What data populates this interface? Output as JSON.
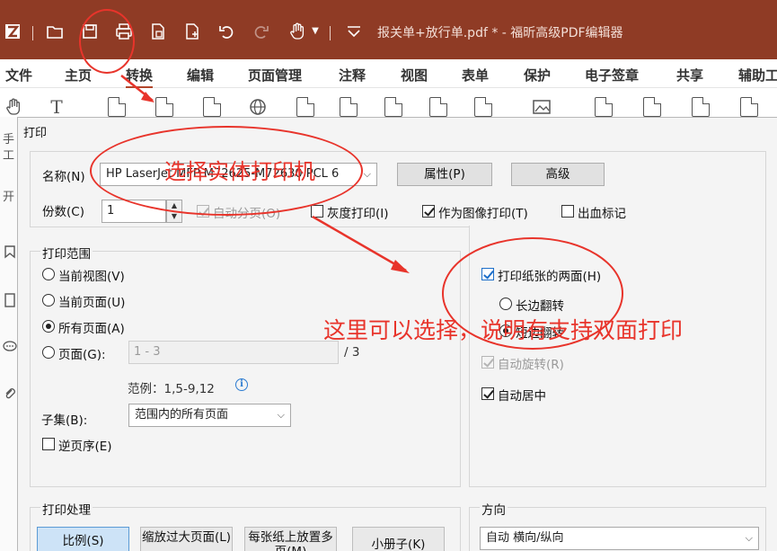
{
  "titlebar": {
    "document_title": "报关单+放行单.pdf * - 福昕高级PDF编辑器"
  },
  "menu": {
    "items": [
      "文件",
      "主页",
      "转换",
      "编辑",
      "页面管理",
      "注释",
      "视图",
      "表单",
      "保护",
      "电子签章",
      "共享",
      "辅助工"
    ]
  },
  "sidebar_clipped": [
    "手",
    "工",
    "开"
  ],
  "dialog": {
    "title": "打印",
    "printer": {
      "name_label": "名称(N)",
      "selected": "HP LaserJet MFP M72625-M72630 PCL 6",
      "properties_button": "属性(P)",
      "advanced_button": "高级"
    },
    "copies": {
      "label": "份数(C)",
      "value": "1"
    },
    "options": {
      "collate": {
        "label": "自动分页(O)",
        "checked": true,
        "disabled": true
      },
      "grayscale": {
        "label": "灰度打印(I)",
        "checked": false
      },
      "as_image": {
        "label": "作为图像打印(T)",
        "checked": true
      },
      "bleed_marks": {
        "label": "出血标记",
        "checked": false
      }
    },
    "print_range": {
      "title": "打印范围",
      "current_view": "当前视图(V)",
      "current_page": "当前页面(U)",
      "all_pages": "所有页面(A)",
      "pages_label": "页面(G):",
      "pages_placeholder": "1 - 3",
      "page_total": "/ 3",
      "example": "范例：1,5-9,12",
      "subset_label": "子集(B):",
      "subset_value": "范围内的所有页面",
      "reverse_label": "逆页序(E)"
    },
    "duplex": {
      "both_sides_label": "打印纸张的两面(H)",
      "long_edge": "长边翻转",
      "short_edge": "短边翻转",
      "auto_rotate": "自动旋转(R)",
      "auto_center": "自动居中"
    },
    "handling": {
      "title": "打印处理",
      "tiles": [
        "比例(S)",
        "缩放过大页面(L)",
        "每张纸上放置多页(M)",
        "小册子(K)"
      ]
    },
    "orientation": {
      "title": "方向",
      "value": "自动 横向/纵向"
    }
  },
  "annotations": {
    "printer_note": "选择实体打印机",
    "duplex_note": "这里可以选择，说明有支持双面打印",
    "color": "#e8342b"
  },
  "colors": {
    "titlebar": "#8f3b25",
    "accent": "#b2462b"
  }
}
